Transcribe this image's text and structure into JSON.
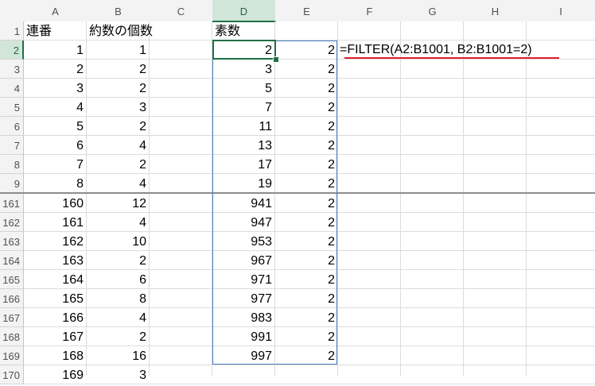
{
  "columns": [
    "A",
    "B",
    "C",
    "D",
    "E",
    "F",
    "G",
    "H",
    "I"
  ],
  "selected_column": "D",
  "top_rows": [
    {
      "row": "1",
      "a": "連番",
      "b": "約数の個数",
      "d": "素数",
      "e": ""
    },
    {
      "row": "2",
      "a": "1",
      "b": "1",
      "d": "2",
      "e": "2"
    },
    {
      "row": "3",
      "a": "2",
      "b": "2",
      "d": "3",
      "e": "2"
    },
    {
      "row": "4",
      "a": "3",
      "b": "2",
      "d": "5",
      "e": "2"
    },
    {
      "row": "5",
      "a": "4",
      "b": "3",
      "d": "7",
      "e": "2"
    },
    {
      "row": "6",
      "a": "5",
      "b": "2",
      "d": "11",
      "e": "2"
    },
    {
      "row": "7",
      "a": "6",
      "b": "4",
      "d": "13",
      "e": "2"
    },
    {
      "row": "8",
      "a": "7",
      "b": "2",
      "d": "17",
      "e": "2"
    },
    {
      "row": "9",
      "a": "8",
      "b": "4",
      "d": "19",
      "e": "2"
    }
  ],
  "bottom_rows": [
    {
      "row": "161",
      "a": "160",
      "b": "12",
      "d": "941",
      "e": "2"
    },
    {
      "row": "162",
      "a": "161",
      "b": "4",
      "d": "947",
      "e": "2"
    },
    {
      "row": "163",
      "a": "162",
      "b": "10",
      "d": "953",
      "e": "2"
    },
    {
      "row": "164",
      "a": "163",
      "b": "2",
      "d": "967",
      "e": "2"
    },
    {
      "row": "165",
      "a": "164",
      "b": "6",
      "d": "971",
      "e": "2"
    },
    {
      "row": "166",
      "a": "165",
      "b": "8",
      "d": "977",
      "e": "2"
    },
    {
      "row": "167",
      "a": "166",
      "b": "4",
      "d": "983",
      "e": "2"
    },
    {
      "row": "168",
      "a": "167",
      "b": "2",
      "d": "991",
      "e": "2"
    },
    {
      "row": "169",
      "a": "168",
      "b": "16",
      "d": "997",
      "e": "2"
    },
    {
      "row": "170",
      "a": "169",
      "b": "3",
      "d": "",
      "e": ""
    }
  ],
  "selected_row": "2",
  "formula_text": "=FILTER(A2:B1001, B2:B1001=2)",
  "colors": {
    "selection": "#1e7145",
    "spill_border": "#4a7fbd",
    "underline": "#e0202a"
  }
}
